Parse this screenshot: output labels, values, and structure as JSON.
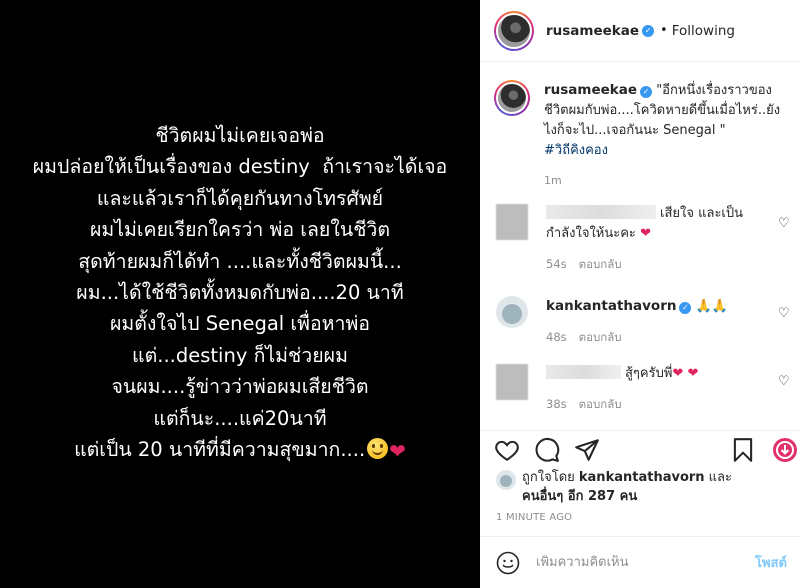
{
  "post_image": {
    "lines": [
      "ชีวิตผมไม่เคยเจอพ่อ",
      "ผมปล่อยให้เป็นเรื่องของ destiny  ถ้าเราจะได้เจอ",
      "และแล้วเราก็ได้คุยกันทางโทรศัพย์",
      "ผมไม่เคยเรียกใครว่า พ่อ เลยในชีวิต",
      "สุดท้ายผมก็ได้ทำ ....และทั้งชีวิตผมนี้...",
      "ผม...ได้ใช้ชีวิตทั้งหมดกับพ่อ....20 นาที",
      "ผมตั้งใจไป Senegal เพื่อหาพ่อ",
      "แต่...destiny ก็ไม่ช่วยผม",
      "จนผม....รู้ข่าวว่าพ่อผมเสียชีวิต",
      "แต่ก็นะ....แค่20นาที",
      "แต่เป็น 20 นาทีที่มีความสุขมาก...."
    ],
    "emoji_heart": "❤",
    "emoji_smile": "smiling-face-emoji"
  },
  "header": {
    "username": "rusameekae",
    "dot": "•",
    "follow_status": "Following"
  },
  "caption": {
    "username": "rusameekae",
    "text": "\"อีกหนึ่งเรื่องราวของชีวิตผมกับพ่อ....โควิดหายดีขึ้นเมื่อไหร่..ยังไงก็จะไป...เจอกันนะ Senegal \"",
    "hashtag": "#วิถีคิงคอง",
    "time": "1m"
  },
  "comments": [
    {
      "username": "",
      "text": "เสียใจ และเป็นกำลังใจให้นะคะ",
      "emoji": "❤",
      "time": "54s",
      "reply": "ตอบกลับ"
    },
    {
      "username": "kankantathavorn",
      "text": "🙏🙏",
      "emoji": "",
      "time": "48s",
      "reply": "ตอบกลับ"
    },
    {
      "username": "",
      "text": "สู้ๆครับพี่",
      "emoji": "❤ ❤",
      "time": "38s",
      "reply": "ตอบกลับ"
    }
  ],
  "likes": {
    "prefix": "ถูกใจโดย ",
    "user": "kankantathavorn",
    "middle": " และ",
    "others": "คนอื่นๆ อีก 287 คน"
  },
  "posted_ago": "1 MINUTE AGO",
  "comment_box": {
    "placeholder": "เพิ่มความคิดเห็น",
    "post_label": "โพสต์"
  },
  "colors": {
    "verified": "#3897f0",
    "link": "#00376b",
    "post_button": "#0095f6",
    "heart": "#e0245e"
  },
  "icons": [
    "heart-icon",
    "comment-icon",
    "share-icon",
    "bookmark-icon",
    "emoji-icon",
    "verified-badge-icon",
    "like-comment-icon"
  ]
}
